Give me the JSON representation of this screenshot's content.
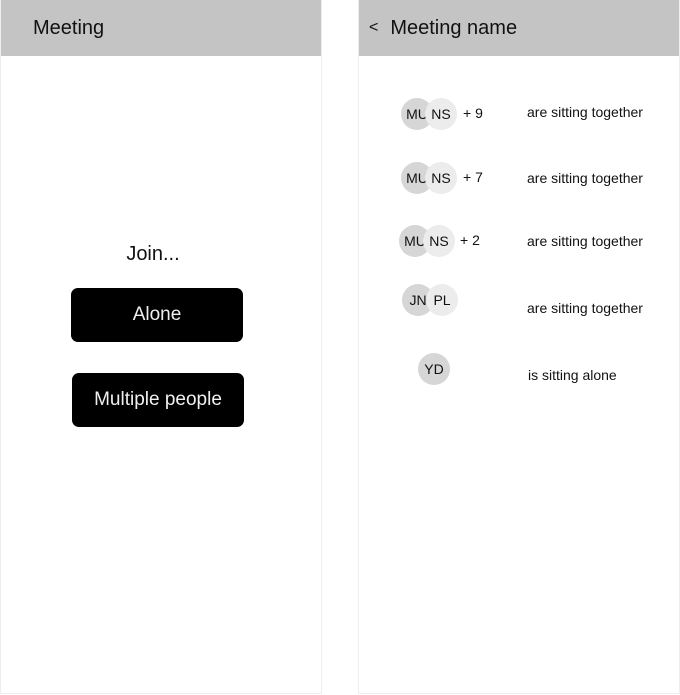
{
  "left_screen": {
    "title": "Meeting",
    "join_prompt": "Join...",
    "buttons": {
      "alone": "Alone",
      "multiple": "Multiple people"
    }
  },
  "right_screen": {
    "back_label": "<",
    "title": "Meeting name",
    "groups": [
      {
        "avatars": [
          "MU",
          "NS"
        ],
        "more": "+ 9",
        "status": "are sitting together"
      },
      {
        "avatars": [
          "MU",
          "NS"
        ],
        "more": "+ 7",
        "status": "are sitting together"
      },
      {
        "avatars": [
          "MU",
          "NS"
        ],
        "more": "+ 2",
        "status": "are sitting together"
      },
      {
        "avatars": [
          "JN",
          "PL"
        ],
        "more": "",
        "status": "are sitting together"
      },
      {
        "avatars": [
          "YD"
        ],
        "more": "",
        "status": "is sitting alone"
      }
    ]
  },
  "colors": {
    "appbar": "#c4c4c4",
    "button": "#000000",
    "avatar_primary": "#d6d6d6",
    "avatar_secondary": "#ececec"
  }
}
